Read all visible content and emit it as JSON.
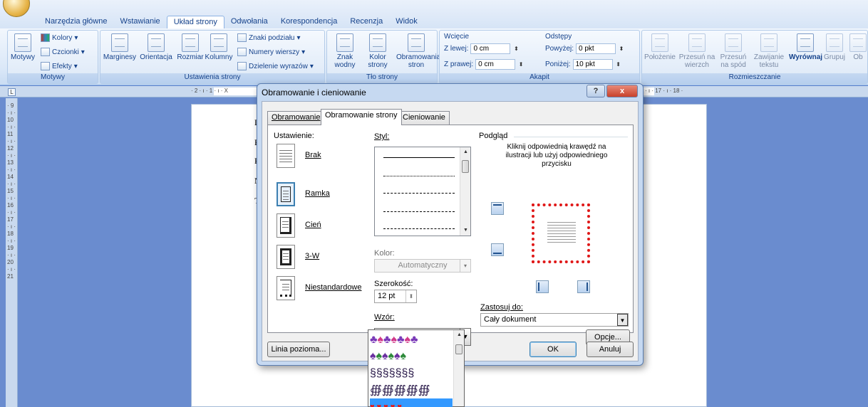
{
  "ribbon": {
    "tabs": [
      "Narzędzia główne",
      "Wstawianie",
      "Układ strony",
      "Odwołania",
      "Korespondencja",
      "Recenzja",
      "Widok"
    ],
    "active_tab": "Układ strony",
    "motywy": {
      "themes_btn": "Motywy",
      "colors": "Kolory",
      "fonts": "Czcionki",
      "effects": "Efekty",
      "group_label": "Motywy"
    },
    "page_setup": {
      "margins": "Marginesy",
      "orientation": "Orientacja",
      "size": "Rozmiar",
      "columns": "Kolumny",
      "breaks": "Znaki podziału",
      "line_numbers": "Numery wierszy",
      "hyphenation": "Dzielenie wyrazów",
      "group_label": "Ustawienia strony"
    },
    "background": {
      "watermark": "Znak wodny",
      "page_color": "Kolor strony",
      "page_borders": "Obramowania stron",
      "group_label": "Tło strony"
    },
    "paragraph": {
      "indent_title": "Wcięcie",
      "left_label": "Z lewej:",
      "left_value": "0 cm",
      "right_label": "Z prawej:",
      "right_value": "0 cm",
      "spacing_title": "Odstępy",
      "before_label": "Powyżej:",
      "before_value": "0 pkt",
      "after_label": "Poniżej:",
      "after_value": "10 pkt",
      "group_label": "Akapit"
    },
    "arrange": {
      "position": "Położenie",
      "bring_front": "Przesuń na wierzch",
      "send_back": "Przesuń na spód",
      "wrap_text": "Zawijanie tekstu",
      "align": "Wyrównaj",
      "group": "Grupuj",
      "rotate": "Ob",
      "group_label": "Rozmieszczanie"
    }
  },
  "ruler": {
    "left_numbers": "· 2 · ı · 1 · ı · X",
    "right_numbers": "· ı · 17 · ı · 18 ·",
    "vertical_numbers": "· 9 · ı · 10 · ı · 11 · ı · 12 · ı · 13 · ı · 14 · ı · 15 · ı · 16 · ı · 17 · ı · 18 · ı · 19 · ı · 20 · ı · 21"
  },
  "document": {
    "letters": [
      "D",
      "P",
      "P",
      "N",
      "T"
    ]
  },
  "dialog": {
    "title": "Obramowanie i cieniowanie",
    "help": "?",
    "close": "x",
    "tabs": [
      "Obramowanie",
      "Obramowanie strony",
      "Cieniowanie"
    ],
    "active_tab": "Obramowanie strony",
    "setting_label": "Ustawienie:",
    "settings": [
      "Brak",
      "Ramka",
      "Cień",
      "3-W",
      "Niestandardowe"
    ],
    "selected_setting": "Ramka",
    "style_label": "Styl:",
    "color_label": "Kolor:",
    "color_value": "Automatyczny",
    "width_label": "Szerokość:",
    "width_value": "12 pt",
    "art_label": "Wzór:",
    "preview_label": "Podgląd",
    "preview_hint": "Kliknij odpowiednią krawędź na ilustracji lub użyj odpowiedniego przycisku",
    "apply_label": "Zastosuj do:",
    "apply_value": "Cały dokument",
    "options_btn": "Opcje...",
    "horizontal_line_btn": "Linia pozioma...",
    "ok_btn": "OK",
    "cancel_btn": "Anuluj"
  },
  "colors": {
    "accent": "#3399ff",
    "heart": "#e21b1b",
    "ribbon_text": "#15428b"
  }
}
